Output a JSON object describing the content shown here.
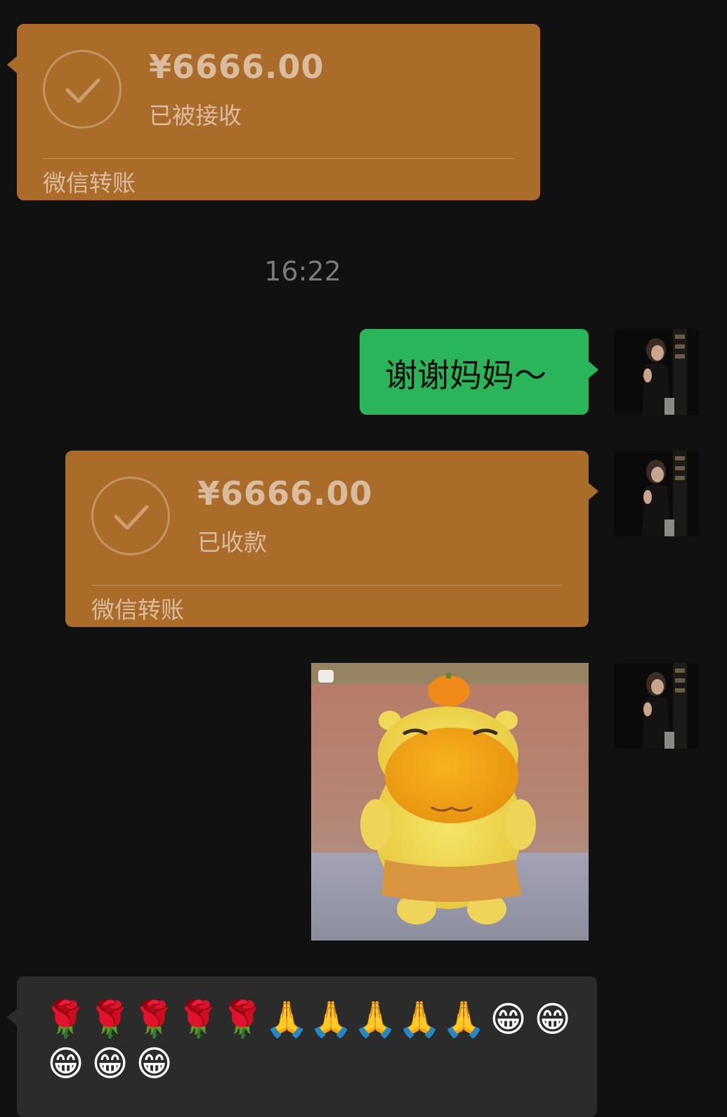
{
  "messages": {
    "transfer_1": {
      "amount": "¥6666.00",
      "status": "已被接收",
      "footer": "微信转账"
    },
    "timestamp": "16:22",
    "text_1": "谢谢妈妈～",
    "transfer_2": {
      "amount": "¥6666.00",
      "status": "已收款",
      "footer": "微信转账"
    },
    "emoji_message": {
      "emojis": [
        "🌹",
        "🌹",
        "🌹",
        "🌹",
        "🌹",
        "🙏",
        "🙏",
        "🙏",
        "🙏",
        "🙏",
        "😁",
        "😁",
        "😁",
        "😁",
        "😁"
      ]
    }
  },
  "colors": {
    "background": "#111111",
    "transfer_bubble": "#ac6c29",
    "sent_bubble": "#2bb559",
    "received_text_bubble": "#2b2b2b"
  },
  "icons": {
    "transfer_status": "check-circle-icon",
    "sticker": "yellow-cartoon-sticker"
  }
}
